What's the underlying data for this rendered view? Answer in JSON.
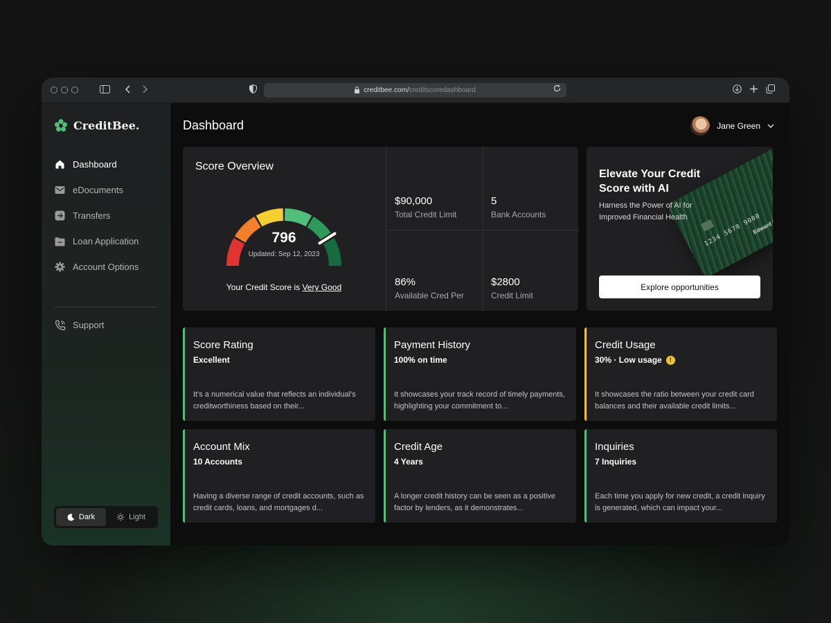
{
  "browser": {
    "url_domain": "creditbee.com/",
    "url_path": "creditscoredashboard"
  },
  "brand": {
    "name": "CreditBee."
  },
  "sidebar": {
    "items": [
      {
        "label": "Dashboard",
        "icon": "home-icon",
        "active": true
      },
      {
        "label": "eDocuments",
        "icon": "mail-icon",
        "active": false
      },
      {
        "label": "Transfers",
        "icon": "transfer-icon",
        "active": false
      },
      {
        "label": "Loan Application",
        "icon": "folder-icon",
        "active": false
      },
      {
        "label": "Account Options",
        "icon": "gear-icon",
        "active": false
      }
    ],
    "support": {
      "label": "Support",
      "icon": "phone-icon"
    },
    "theme": {
      "dark": "Dark",
      "light": "Light",
      "selected": "Dark"
    }
  },
  "header": {
    "title": "Dashboard",
    "user_name": "Jane Green"
  },
  "score": {
    "title": "Score Overview",
    "value": "796",
    "updated": "Updated: Sep 12, 2023",
    "caption_prefix": "Your Credit Score is ",
    "caption_rating": "Very Good",
    "gauge_fraction": 0.82,
    "gauge_colors": [
      "#e0342f",
      "#f2802a",
      "#f5cf30",
      "#4fbf7a",
      "#2d9a5c",
      "#186b3f"
    ]
  },
  "stats": [
    {
      "value": "$90,000",
      "label": "Total Credit Limit"
    },
    {
      "value": "5",
      "label": "Bank Accounts"
    },
    {
      "value": "86%",
      "label": "Available Cred Per"
    },
    {
      "value": "$2800",
      "label": "Credit Limit"
    }
  ],
  "promo": {
    "title": "Elevate Your Credit Score with AI",
    "subtitle": "Harness the Power of AI for Improved Financial Health",
    "button": "Explore opportunities",
    "card_number": "1234 5678 9000",
    "card_name": "Edward Hunt"
  },
  "metrics": [
    {
      "title": "Score Rating",
      "subtitle": "Excellent",
      "desc": "It's a numerical value that reflects an individual's creditworthiness based on their...",
      "accent": "#4fbf7a"
    },
    {
      "title": "Payment History",
      "subtitle": "100% on time",
      "desc": "It showcases your track record of timely payments, highlighting your commitment to...",
      "accent": "#4fbf7a"
    },
    {
      "title": "Credit Usage",
      "subtitle": "30% · Low usage",
      "desc": "It showcases the ratio between your credit card balances and their available credit limits...",
      "accent": "#f1c232",
      "warning": "!"
    },
    {
      "title": "Account Mix",
      "subtitle": "10 Accounts",
      "desc": "Having a diverse range of credit accounts, such as credit cards, loans, and mortgages d...",
      "accent": "#4fbf7a"
    },
    {
      "title": "Credit Age",
      "subtitle": "4 Years",
      "desc": "A longer credit history can be seen as a positive factor by lenders, as it demonstrates...",
      "accent": "#4fbf7a"
    },
    {
      "title": "Inquiries",
      "subtitle": "7 Inquiries",
      "desc": "Each time you apply for new credit, a credit inquiry is generated, which can impact your...",
      "accent": "#4fbf7a"
    }
  ]
}
